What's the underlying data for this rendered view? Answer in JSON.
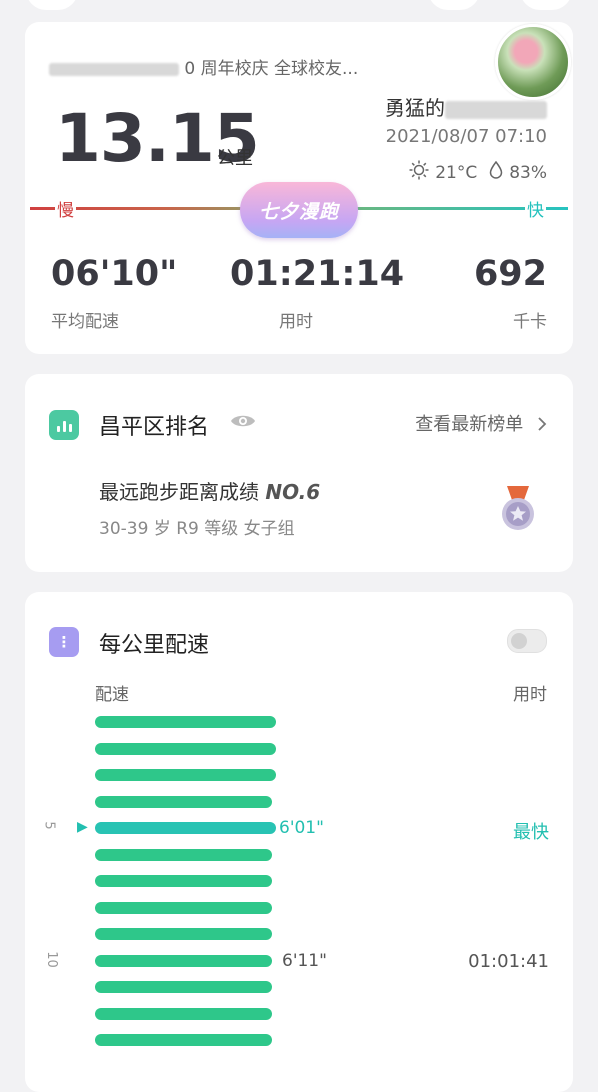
{
  "run": {
    "event_title_visible": "0 周年校庆 全球校友...",
    "distance": "13.15",
    "distance_unit": "公里",
    "nickname_visible": "勇猛的",
    "datetime": "2021/08/07 07:10",
    "temperature": "21°C",
    "humidity": "83%",
    "slow_label": "慢",
    "fast_label": "快",
    "badge_text": "七夕漫跑",
    "stats": [
      {
        "value": "06'10\"",
        "label": "平均配速"
      },
      {
        "value": "01:21:14",
        "label": "用时"
      },
      {
        "value": "692",
        "label": "千卡"
      }
    ]
  },
  "ranking": {
    "title": "昌平区排名",
    "link": "查看最新榜单",
    "achievement": "最远跑步距离成绩",
    "rank": "NO.6",
    "subtitle": "30-39 岁 R9 等级 女子组"
  },
  "splits": {
    "title": "每公里配速",
    "icon_glyph": "⋮",
    "col_pace": "配速",
    "col_time": "用时",
    "best_label": "最快",
    "km5_label": "5",
    "km10_label": "10",
    "pace_km5": "6'01\"",
    "pace_km10": "6'11\"",
    "time_km10": "01:01:41",
    "bar_relative_lengths": [
      1.0,
      1.0,
      1.0,
      0.98,
      1.0,
      0.98,
      0.98,
      0.98,
      0.98,
      0.98,
      0.98,
      0.98,
      0.98
    ]
  },
  "colors": {
    "accent_green": "#2ec78a",
    "best_teal": "#28c3b3",
    "slow_red": "#d04040",
    "rank_icon": "#4cc9a1",
    "split_icon": "#a69cf1"
  }
}
